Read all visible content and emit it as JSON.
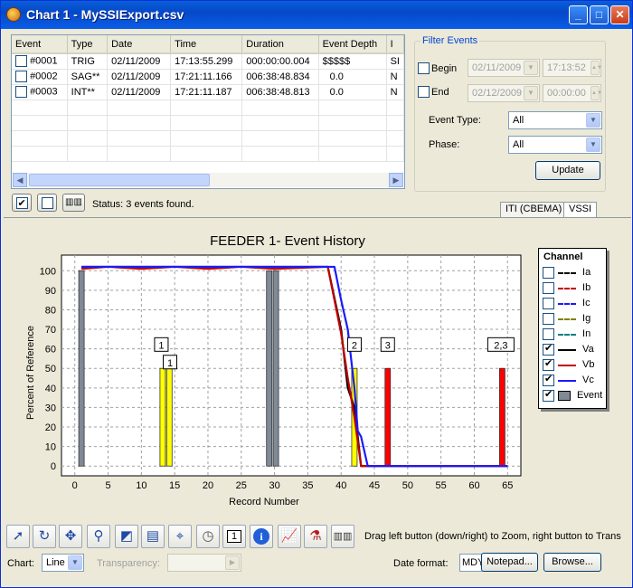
{
  "window": {
    "title": "Chart 1 - MySSIExport.csv",
    "min": "_",
    "max": "□",
    "close": "✕"
  },
  "events_table": {
    "columns": [
      "Event",
      "Type",
      "Date",
      "Time",
      "Duration",
      "Event Depth",
      "I"
    ],
    "rows": [
      [
        "#0001",
        "TRIG",
        "02/11/2009",
        "17:13:55.299",
        "000:00:00.004",
        "$$$$$",
        "SI"
      ],
      [
        "#0002",
        "SAG**",
        "02/11/2009",
        "17:21:11.166",
        "006:38:48.834",
        "0.0",
        "N"
      ],
      [
        "#0003",
        "INT**",
        "02/11/2009",
        "17:21:11.187",
        "006:38:48.813",
        "0.0",
        "N"
      ]
    ]
  },
  "status": "Status: 3 events found.",
  "filter": {
    "title": "Filter Events",
    "begin_label": "Begin",
    "begin_date": "02/11/2009",
    "begin_time": "17:13:52",
    "end_label": "End",
    "end_date": "02/12/2009",
    "end_time": "00:00:00",
    "event_type_label": "Event Type:",
    "event_type_value": "All",
    "phase_label": "Phase:",
    "phase_value": "All",
    "update_label": "Update"
  },
  "tabs": [
    "ITI (CBEMA)",
    "VSSI"
  ],
  "chart_data": {
    "type": "line",
    "title": "FEEDER 1- Event History",
    "xlabel": "Record Number",
    "ylabel": "Percent of Reference",
    "xlim": [
      -2,
      67
    ],
    "ylim": [
      -5,
      108
    ],
    "xticks": [
      0,
      5,
      10,
      15,
      20,
      25,
      30,
      35,
      40,
      45,
      50,
      55,
      60,
      65
    ],
    "yticks": [
      0,
      10,
      20,
      30,
      40,
      50,
      60,
      70,
      80,
      90,
      100
    ],
    "grid": true,
    "series": [
      {
        "name": "Va",
        "color": "#000000",
        "x": [
          1,
          38,
          40,
          41,
          42,
          43,
          65
        ],
        "y": [
          102,
          102,
          70,
          40,
          30,
          0,
          0
        ]
      },
      {
        "name": "Vb",
        "color": "#c00000",
        "x": [
          1,
          5,
          10,
          15,
          20,
          25,
          30,
          38,
          40,
          41,
          42,
          43,
          65
        ],
        "y": [
          101,
          102,
          101,
          102,
          101,
          102,
          101,
          102,
          68,
          45,
          25,
          0,
          0
        ]
      },
      {
        "name": "Vc",
        "color": "#1a1aff",
        "x": [
          1,
          39,
          40,
          41,
          42,
          42.5,
          43,
          44,
          65
        ],
        "y": [
          102,
          102,
          85,
          70,
          40,
          18,
          15,
          0,
          0
        ]
      }
    ],
    "event_bars": [
      {
        "x": 1,
        "value": 100,
        "color": "#808a96"
      },
      {
        "x": 13.2,
        "value": 50,
        "color": "#ffff00"
      },
      {
        "x": 14.2,
        "value": 50,
        "color": "#ffff00"
      },
      {
        "x": 29.2,
        "value": 100,
        "color": "#808a96"
      },
      {
        "x": 30.2,
        "value": 100,
        "color": "#808a96"
      },
      {
        "x": 42,
        "value": 50,
        "color": "#ffff00"
      },
      {
        "x": 47,
        "value": 50,
        "color": "#ff0000"
      },
      {
        "x": 64.2,
        "value": 50,
        "color": "#ff0000"
      }
    ],
    "annotations": [
      {
        "text": "1",
        "x": 13,
        "y": 62
      },
      {
        "text": "1",
        "x": 14.3,
        "y": 53
      },
      {
        "text": "2",
        "x": 42,
        "y": 62
      },
      {
        "text": "3",
        "x": 47,
        "y": 62
      },
      {
        "text": "2,3",
        "x": 64,
        "y": 62
      }
    ]
  },
  "legend": {
    "title": "Channel",
    "items": [
      {
        "label": "Ia",
        "checked": false,
        "color": "#000000",
        "style": "dash"
      },
      {
        "label": "Ib",
        "checked": false,
        "color": "#c00000",
        "style": "dash"
      },
      {
        "label": "Ic",
        "checked": false,
        "color": "#1a1aff",
        "style": "dash"
      },
      {
        "label": "Ig",
        "checked": false,
        "color": "#808000",
        "style": "dash"
      },
      {
        "label": "In",
        "checked": false,
        "color": "#008080",
        "style": "dash"
      },
      {
        "label": "Va",
        "checked": true,
        "color": "#000000",
        "style": "solid"
      },
      {
        "label": "Vb",
        "checked": true,
        "color": "#c00000",
        "style": "solid"
      },
      {
        "label": "Vc",
        "checked": true,
        "color": "#1a1aff",
        "style": "solid"
      },
      {
        "label": "Event",
        "checked": true,
        "color": "#808a96",
        "style": "box"
      }
    ]
  },
  "toolbar": {
    "icons": [
      "pointer-icon",
      "rotate-icon",
      "pan-icon",
      "zoom-icon",
      "view3d-icon",
      "axis-icon",
      "crosshair-icon",
      "clock-icon",
      "page-icon",
      "info-icon",
      "chart-icon",
      "probe-icon",
      "export-icon"
    ],
    "page_number": "1",
    "hint": "Drag left button (down/right) to Zoom, right button to Trans"
  },
  "bottom": {
    "chart_label": "Chart:",
    "chart_value": "Line",
    "transparency_label": "Transparency:",
    "date_format_label": "Date format:",
    "date_format_value": "MDY",
    "notepad_label": "Notepad...",
    "browse_label": "Browse..."
  }
}
